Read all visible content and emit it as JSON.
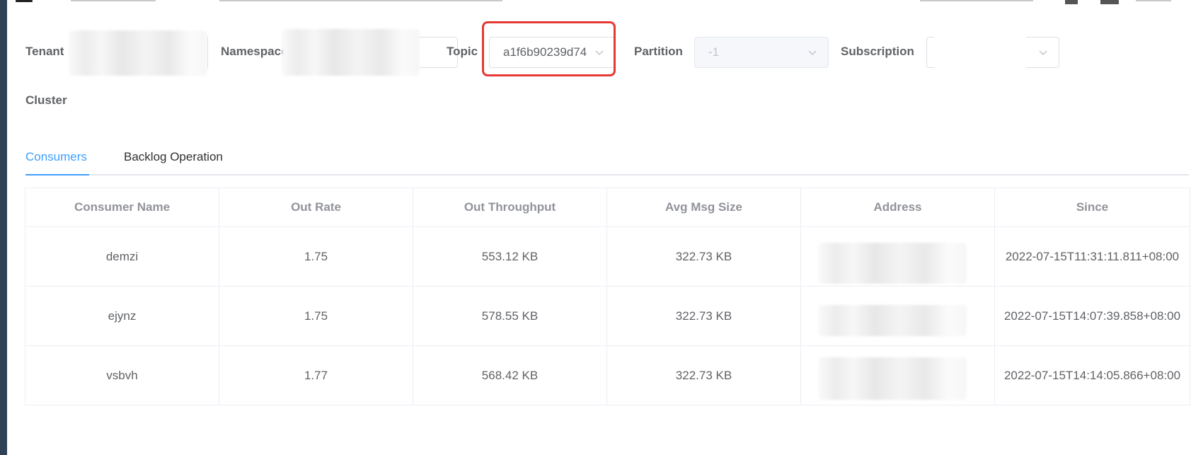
{
  "filters": {
    "tenant_label": "Tenant",
    "namespace_label": "Namespace",
    "topic_label": "Topic",
    "topic_value": "a1f6b90239d74",
    "partition_label": "Partition",
    "partition_value": "-1",
    "subscription_label": "Subscription",
    "cluster_label": "Cluster"
  },
  "tabs": [
    "Consumers",
    "Backlog Operation"
  ],
  "active_tab": "Consumers",
  "table": {
    "columns": [
      "Consumer Name",
      "Out Rate",
      "Out Throughput",
      "Avg Msg Size",
      "Address",
      "Since"
    ],
    "rows": [
      {
        "name": "demzi",
        "out_rate": "1.75",
        "out_throughput": "553.12 KB",
        "avg_msg_size": "322.73 KB",
        "since": "2022-07-15T11:31:11.811+08:00"
      },
      {
        "name": "ejynz",
        "out_rate": "1.75",
        "out_throughput": "578.55 KB",
        "avg_msg_size": "322.73 KB",
        "since": "2022-07-15T14:07:39.858+08:00"
      },
      {
        "name": "vsbvh",
        "out_rate": "1.77",
        "out_throughput": "568.42 KB",
        "avg_msg_size": "322.73 KB",
        "since": "2022-07-15T14:14:05.866+08:00"
      }
    ]
  },
  "colors": {
    "accent": "#409eff",
    "highlight": "#e53935",
    "sidebar": "#304156"
  },
  "icons": {
    "dropdown": "chevron-down-icon",
    "menu": "hamburger-menu-icon"
  }
}
